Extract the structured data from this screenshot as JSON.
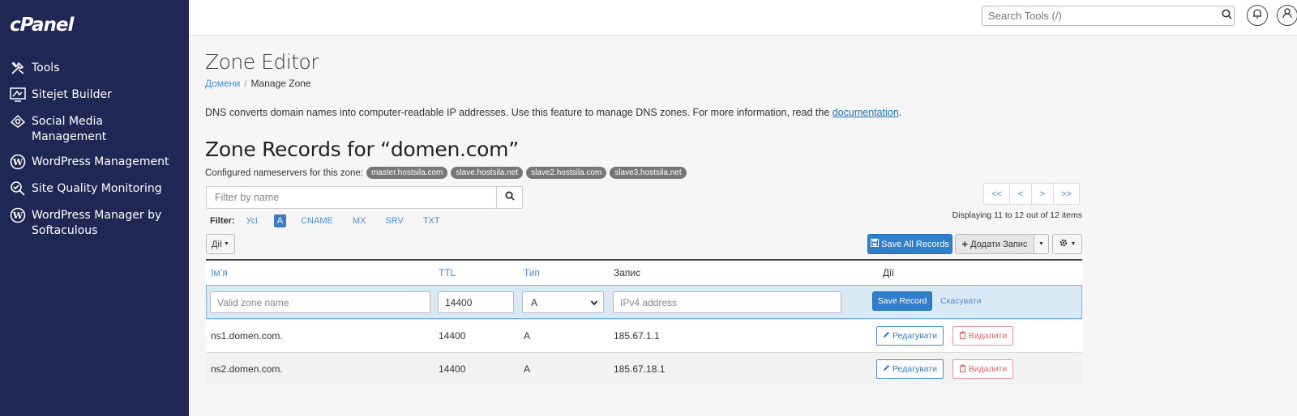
{
  "app": {
    "logo": "cPanel"
  },
  "sidebar": {
    "items": [
      {
        "label": "Tools",
        "icon": "tools-icon"
      },
      {
        "label": "Sitejet Builder",
        "icon": "sitejet-icon"
      },
      {
        "label": "Social Media Management",
        "icon": "social-media-icon"
      },
      {
        "label": "WordPress Management",
        "icon": "wordpress-icon"
      },
      {
        "label": "Site Quality Monitoring",
        "icon": "site-quality-icon"
      },
      {
        "label": "WordPress Manager by Softaculous",
        "icon": "wordpress-icon"
      }
    ]
  },
  "topbar": {
    "search_placeholder": "Search Tools (/)"
  },
  "page": {
    "title": "Zone Editor",
    "breadcrumb": {
      "parent": "Домени",
      "current": "Manage Zone"
    },
    "intro_text": "DNS converts domain names into computer-readable IP addresses. Use this feature to manage DNS zones. For more information, read the",
    "intro_link": "documentation",
    "intro_end": "."
  },
  "zone": {
    "title": "Zone Records for “domen.com”",
    "nameservers_label": "Configured nameservers for this zone:",
    "nameservers": [
      "master.hostsila.com",
      "slave.hostsila.net",
      "slave2.hostsila.com",
      "slave3.hostsila.net"
    ]
  },
  "filter": {
    "placeholder": "Filter by name",
    "label": "Filter:",
    "types": [
      "Усі",
      "A",
      "CNAME",
      "MX",
      "SRV",
      "TXT"
    ],
    "active": "A"
  },
  "pagination": {
    "buttons": [
      "<<",
      "<",
      ">",
      ">>"
    ],
    "status": "Displaying 11 to 12 out of 12 items"
  },
  "toolbar": {
    "actions_label": "Дії",
    "save_all_label": "Save All Records",
    "add_record_label": "Додати Запис"
  },
  "table": {
    "headers": {
      "name": "Ім’я",
      "ttl": "TTL",
      "type": "Тип",
      "record": "Запис",
      "actions": "Дії"
    },
    "edit_row": {
      "name_placeholder": "Valid zone name",
      "ttl_value": "14400",
      "type_value": "A",
      "record_placeholder": "IPv4 address",
      "save_label": "Save Record",
      "cancel_label": "Скасувати"
    },
    "rows": [
      {
        "name": "ns1.domen.com.",
        "ttl": "14400",
        "type": "A",
        "record": "185.67.1.1"
      },
      {
        "name": "ns2.domen.com.",
        "ttl": "14400",
        "type": "A",
        "record": "185.67.18.1"
      }
    ],
    "edit_label": "Редагувати",
    "delete_label": "Видалити"
  },
  "colors": {
    "sidebar": "#1f2754",
    "primary": "#2f7fca",
    "link": "#4d8ed2",
    "danger": "#d66666"
  }
}
